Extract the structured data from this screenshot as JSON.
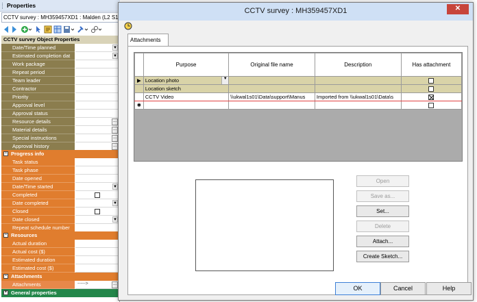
{
  "properties": {
    "title": "Properties",
    "object_combo": "CCTV survey : MH359457XD1 : Malden (L2 S1)",
    "grid_header": "CCTV survey Object Properties",
    "rows_top": [
      {
        "label": "Date/Time planned",
        "control": "dropdown"
      },
      {
        "label": "Estimated completion dat",
        "control": "dropdown"
      },
      {
        "label": "Work package",
        "control": "none"
      },
      {
        "label": "Repeat period",
        "control": "none"
      },
      {
        "label": "Team leader",
        "control": "none"
      },
      {
        "label": "Contractor",
        "control": "none"
      },
      {
        "label": "Priority",
        "control": "none"
      },
      {
        "label": "Approval level",
        "control": "none"
      },
      {
        "label": "Approval status",
        "control": "none"
      },
      {
        "label": "Resource details",
        "control": "ellipsis"
      },
      {
        "label": "Material details",
        "control": "ellipsis"
      },
      {
        "label": "Special instructions",
        "control": "ellipsis"
      },
      {
        "label": "Approval history",
        "control": "ellipsis"
      }
    ],
    "cat_progress": "Progress info",
    "rows_progress": [
      {
        "label": "Task status",
        "control": "none"
      },
      {
        "label": "Task phase",
        "control": "none"
      },
      {
        "label": "Date opened",
        "control": "none"
      },
      {
        "label": "Date/Time started",
        "control": "dropdown"
      },
      {
        "label": "Completed",
        "control": "checkbox"
      },
      {
        "label": "Date completed",
        "control": "dropdown"
      },
      {
        "label": "Closed",
        "control": "checkbox"
      },
      {
        "label": "Date closed",
        "control": "dropdown"
      },
      {
        "label": "Repeat schedule number",
        "control": "none"
      }
    ],
    "cat_resources": "Resources",
    "rows_resources": [
      {
        "label": "Actual duration"
      },
      {
        "label": "Actual cost ($)"
      },
      {
        "label": "Estimated duration"
      },
      {
        "label": "Estimated cost ($)"
      }
    ],
    "cat_attachments": "Attachments",
    "attachments_row": {
      "label": "Attachments",
      "value": "----->"
    },
    "cat_general": "General properties"
  },
  "dialog": {
    "title": "CCTV survey : MH359457XD1",
    "close_glyph": "✕",
    "tab_label": "Attachments",
    "columns": [
      "Purpose",
      "Original file name",
      "Description",
      "Has attachment"
    ],
    "rows": [
      {
        "marker": "▶",
        "purpose": "Location photo",
        "file": "",
        "description": "",
        "has_attachment": false,
        "style": "olive"
      },
      {
        "marker": "",
        "purpose": "Location sketch",
        "file": "",
        "description": "",
        "has_attachment": false,
        "style": "olive"
      },
      {
        "marker": "",
        "purpose": "CCTV Video",
        "file": "\\\\ukwal1s01\\Data\\support\\Manus",
        "description": "Imported from \\\\ukwal1s01\\Data\\s",
        "has_attachment": true,
        "style": "selrow"
      },
      {
        "marker": "✱",
        "purpose": "",
        "file": "",
        "description": "",
        "has_attachment": false,
        "style": "white"
      }
    ],
    "side_buttons": [
      {
        "label": "Open",
        "enabled": false
      },
      {
        "label": "Save as...",
        "enabled": false
      },
      {
        "label": "Set...",
        "enabled": true
      },
      {
        "label": "Delete",
        "enabled": false
      },
      {
        "label": "Attach...",
        "enabled": true
      },
      {
        "label": "Create Sketch...",
        "enabled": true
      }
    ],
    "footer": {
      "ok": "OK",
      "cancel": "Cancel",
      "help": "Help"
    }
  }
}
